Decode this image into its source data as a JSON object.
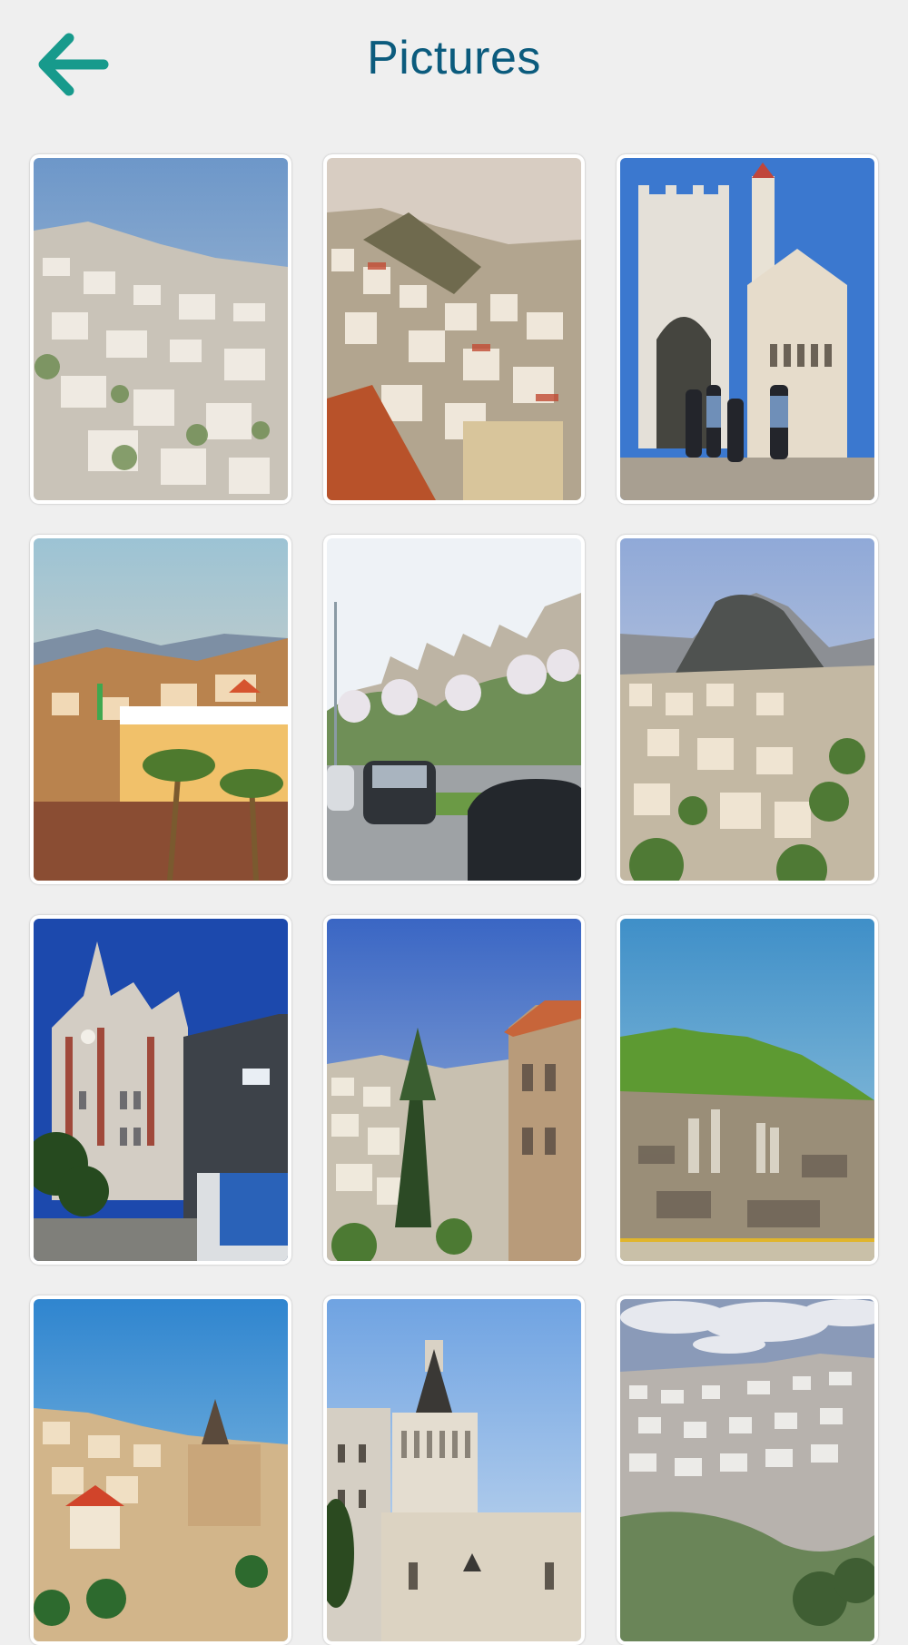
{
  "header": {
    "title": "Pictures",
    "back_icon": "arrow-left-icon",
    "accent": "#179a8c",
    "title_color": "#0b5b7d"
  },
  "gallery": {
    "items": [
      {
        "name": "hillside-town-photo"
      },
      {
        "name": "hill-city-rooftops-photo"
      },
      {
        "name": "church-plaza-photo"
      },
      {
        "name": "town-sunset-palms-photo"
      },
      {
        "name": "street-cars-photo"
      },
      {
        "name": "mountain-town-photo"
      },
      {
        "name": "church-tower-photo"
      },
      {
        "name": "city-view-tree-photo"
      },
      {
        "name": "ruins-hill-photo"
      },
      {
        "name": "basilica-town-photo"
      },
      {
        "name": "basilica-dome-photo"
      },
      {
        "name": "city-panorama-photo"
      }
    ]
  }
}
